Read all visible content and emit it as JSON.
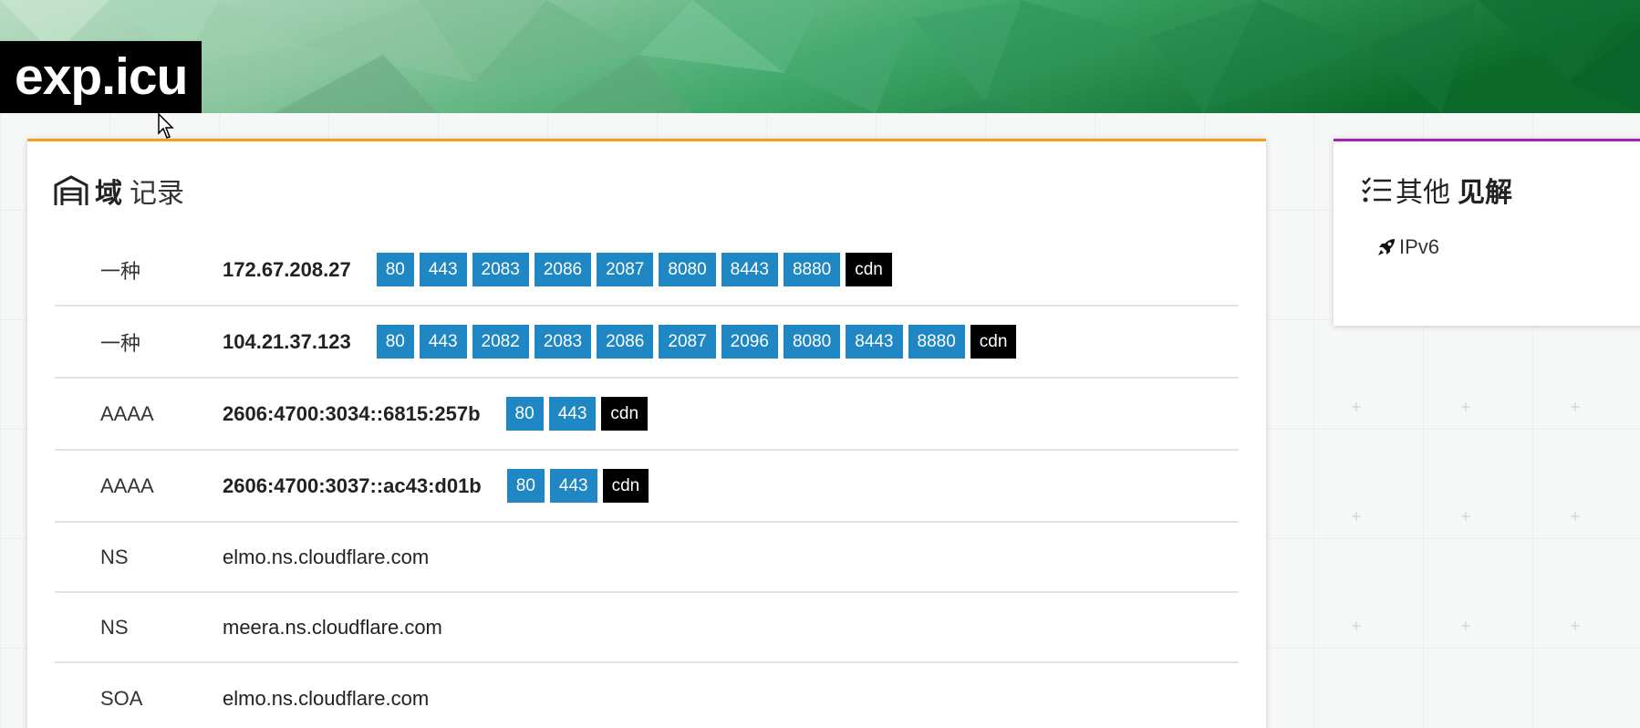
{
  "site": {
    "title": "exp.icu"
  },
  "records_card": {
    "heading_icon": "garage-icon",
    "heading_bold": "域",
    "heading_light": "记录",
    "accent": "#f39c1f",
    "rows": [
      {
        "type": "一种",
        "value": "172.67.208.27",
        "bold": true,
        "ports": [
          "80",
          "443",
          "2083",
          "2086",
          "2087",
          "8080",
          "8443",
          "8880"
        ],
        "cdn": "cdn"
      },
      {
        "type": "一种",
        "value": "104.21.37.123",
        "bold": true,
        "ports": [
          "80",
          "443",
          "2082",
          "2083",
          "2086",
          "2087",
          "2096",
          "8080",
          "8443",
          "8880"
        ],
        "cdn": "cdn"
      },
      {
        "type": "AAAA",
        "value": "2606:4700:3034::6815:257b",
        "bold": true,
        "ports": [
          "80",
          "443"
        ],
        "cdn": "cdn"
      },
      {
        "type": "AAAA",
        "value": "2606:4700:3037::ac43:d01b",
        "bold": true,
        "ports": [
          "80",
          "443"
        ],
        "cdn": "cdn"
      },
      {
        "type": "NS",
        "value": "elmo.ns.cloudflare.com",
        "bold": false,
        "ports": [],
        "cdn": null
      },
      {
        "type": "NS",
        "value": "meera.ns.cloudflare.com",
        "bold": false,
        "ports": [],
        "cdn": null
      },
      {
        "type": "SOA",
        "value": "elmo.ns.cloudflare.com",
        "bold": false,
        "ports": [],
        "cdn": null
      }
    ]
  },
  "insights_card": {
    "heading_icon": "checklist-icon",
    "heading_light": "其他",
    "heading_bold": "见解",
    "accent": "#a321b3",
    "items": [
      {
        "icon": "rocket-icon",
        "label": "IPv6"
      }
    ]
  },
  "colors": {
    "port_badge": "#1f87c4",
    "cdn_badge": "#000000"
  }
}
